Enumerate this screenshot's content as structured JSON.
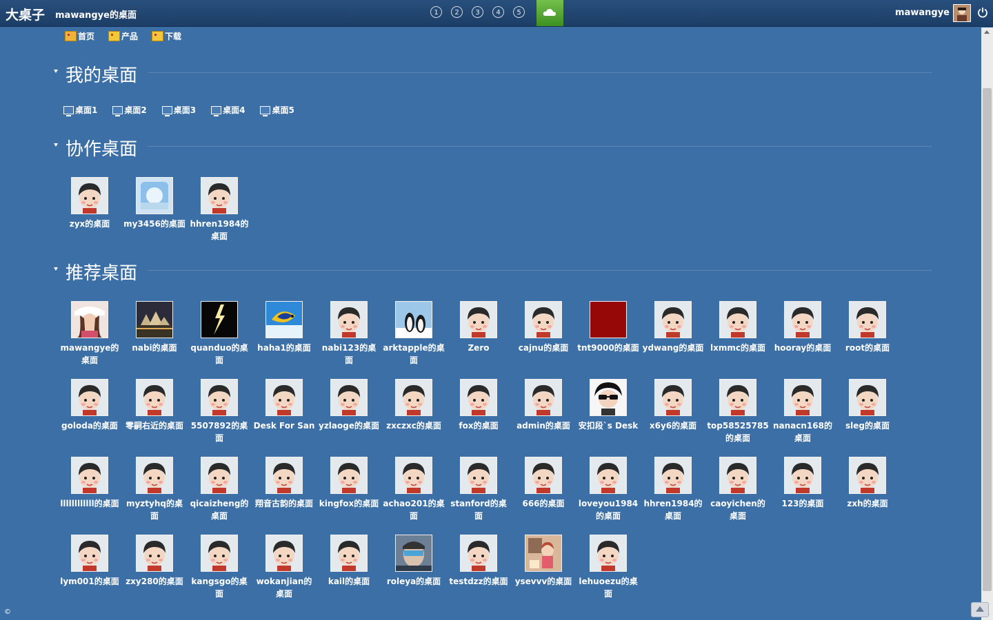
{
  "header": {
    "brand": "大桌子",
    "desk_title": "mawangye的桌面",
    "pages": [
      "1",
      "2",
      "3",
      "4",
      "5"
    ],
    "username": "mawangye"
  },
  "nav": [
    {
      "label": "首页",
      "icon": "home-icon"
    },
    {
      "label": "产品",
      "icon": "product-icon"
    },
    {
      "label": "下载",
      "icon": "download-icon"
    }
  ],
  "sections": {
    "my": "我的桌面",
    "coop": "协作桌面",
    "recommend": "推荐桌面"
  },
  "my_desks": [
    "桌面1",
    "桌面2",
    "桌面3",
    "桌面4",
    "桌面5"
  ],
  "coop_desks": [
    {
      "label": "zyx的桌面",
      "thumb": "face"
    },
    {
      "label": "my3456的桌面",
      "thumb": "sky"
    },
    {
      "label": "hhren1984的桌面",
      "thumb": "face"
    }
  ],
  "recommended": [
    {
      "label": "mawangye的桌面",
      "thumb": "girl"
    },
    {
      "label": "nabi的桌面",
      "thumb": "city"
    },
    {
      "label": "quanduo的桌面",
      "thumb": "lightning"
    },
    {
      "label": "haha1的桌面",
      "thumb": "fish"
    },
    {
      "label": "nabi123的桌面",
      "thumb": "face"
    },
    {
      "label": "arktapple的桌面",
      "thumb": "penguin"
    },
    {
      "label": "Zero",
      "thumb": "face"
    },
    {
      "label": "cajnu的桌面",
      "thumb": "face"
    },
    {
      "label": "tnt9000的桌面",
      "thumb": "red"
    },
    {
      "label": "ydwang的桌面",
      "thumb": "face"
    },
    {
      "label": "lxmmc的桌面",
      "thumb": "face"
    },
    {
      "label": "hooray的桌面",
      "thumb": "face"
    },
    {
      "label": "root的桌面",
      "thumb": "face"
    },
    {
      "label": "goloda的桌面",
      "thumb": "face"
    },
    {
      "label": "零嗣右近的桌面",
      "thumb": "face"
    },
    {
      "label": "5507892的桌面",
      "thumb": "face"
    },
    {
      "label": "Desk For San",
      "thumb": "face"
    },
    {
      "label": "yzlaoge的桌面",
      "thumb": "face"
    },
    {
      "label": "zxczxc的桌面",
      "thumb": "face"
    },
    {
      "label": "fox的桌面",
      "thumb": "face"
    },
    {
      "label": "admin的桌面",
      "thumb": "face"
    },
    {
      "label": "安扣段`s Desk",
      "thumb": "cool"
    },
    {
      "label": "x6y6的桌面",
      "thumb": "face"
    },
    {
      "label": "top58525785的桌面",
      "thumb": "face"
    },
    {
      "label": "nanacn168的桌面",
      "thumb": "face"
    },
    {
      "label": "sleg的桌面",
      "thumb": "face"
    },
    {
      "label": "llllllllllll的桌面",
      "thumb": "face"
    },
    {
      "label": "myztyhq的桌面",
      "thumb": "face"
    },
    {
      "label": "qicaizheng的桌面",
      "thumb": "face"
    },
    {
      "label": "翔音古韵的桌面",
      "thumb": "face"
    },
    {
      "label": "kingfox的桌面",
      "thumb": "face"
    },
    {
      "label": "achao201的桌面",
      "thumb": "face"
    },
    {
      "label": "stanford的桌面",
      "thumb": "face"
    },
    {
      "label": "666的桌面",
      "thumb": "face"
    },
    {
      "label": "loveyou1984的桌面",
      "thumb": "face"
    },
    {
      "label": "hhren1984的桌面",
      "thumb": "face"
    },
    {
      "label": "caoyichen的桌面",
      "thumb": "face"
    },
    {
      "label": "123的桌面",
      "thumb": "face"
    },
    {
      "label": "zxh的桌面",
      "thumb": "face"
    },
    {
      "label": "lym001的桌面",
      "thumb": "face"
    },
    {
      "label": "zxy280的桌面",
      "thumb": "face"
    },
    {
      "label": "kangsgo的桌面",
      "thumb": "face"
    },
    {
      "label": "wokanjian的桌面",
      "thumb": "face"
    },
    {
      "label": "kail的桌面",
      "thumb": "face"
    },
    {
      "label": "roleya的桌面",
      "thumb": "photo"
    },
    {
      "label": "testdzz的桌面",
      "thumb": "face"
    },
    {
      "label": "ysevvv的桌面",
      "thumb": "cartoon"
    },
    {
      "label": "lehuoezu的桌面",
      "thumb": "face"
    }
  ],
  "footer": {
    "copyright": "©"
  },
  "colors": {
    "background": "#3b6fa5",
    "topbar": "#1f4470",
    "accent_tab": "#5aa935"
  }
}
